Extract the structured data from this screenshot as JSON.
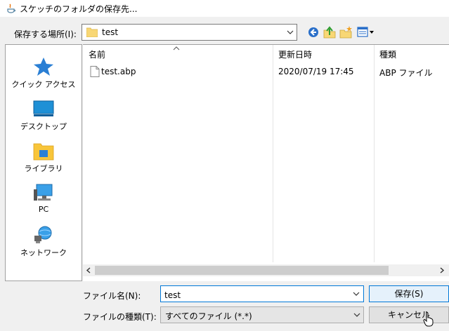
{
  "window": {
    "title": "スケッチのフォルダの保存先..."
  },
  "lookin": {
    "label": "保存する場所(I):",
    "value": "test"
  },
  "places": [
    {
      "label": "クイック アクセス",
      "icon": "star-icon"
    },
    {
      "label": "デスクトップ",
      "icon": "desktop-icon"
    },
    {
      "label": "ライブラリ",
      "icon": "library-icon"
    },
    {
      "label": "PC",
      "icon": "pc-icon"
    },
    {
      "label": "ネットワーク",
      "icon": "network-icon"
    }
  ],
  "filelist": {
    "columns": {
      "name": "名前",
      "date": "更新日時",
      "type": "種類"
    },
    "rows": [
      {
        "name": "test.abp",
        "date": "2020/07/19 17:45",
        "type": "ABP ファイル"
      }
    ]
  },
  "filename": {
    "label": "ファイル名(N):",
    "value": "test"
  },
  "filetype": {
    "label": "ファイルの種類(T):",
    "value": "すべてのファイル (*.*)"
  },
  "buttons": {
    "save": "保存(S)",
    "cancel": "キャンセル"
  },
  "colors": {
    "accent": "#0078d7",
    "folder": "#f8d775",
    "desktop": "#1e90d6"
  }
}
